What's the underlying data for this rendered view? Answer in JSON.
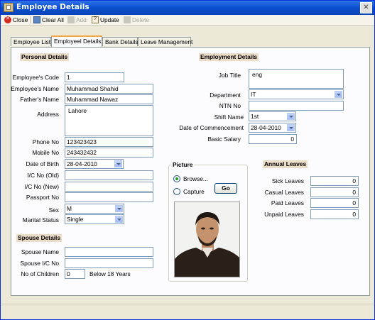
{
  "window": {
    "title": "Employee Details",
    "close_glyph": "✕"
  },
  "toolbar": {
    "close_label": "Close",
    "clear_all_label": "Clear All",
    "add_label": "Add",
    "update_label": "Update",
    "delete_label": "Delete"
  },
  "tabs": [
    "Employee List",
    "Employeel Details",
    "Bank Details",
    "Leave Management"
  ],
  "personal": {
    "section_title": "Personal Details",
    "employee_code": {
      "label": "Employee's Code",
      "value": "1"
    },
    "employee_name": {
      "label": "Employee's Name",
      "value": "Muhammad Shahid"
    },
    "father_name": {
      "label": "Father's Name",
      "value": "Muhammad Nawaz"
    },
    "address": {
      "label": "Address",
      "value": "Lahore"
    },
    "phone": {
      "label": "Phone No",
      "value": "123423423"
    },
    "mobile": {
      "label": "Mobile No",
      "value": "243432432"
    },
    "dob": {
      "label": "Date of Birth",
      "value": "28-04-2010"
    },
    "ic_old": {
      "label": "I/C No (Old)",
      "value": ""
    },
    "ic_new": {
      "label": "I/C No (New)",
      "value": ""
    },
    "passport": {
      "label": "Passport No",
      "value": ""
    },
    "sex": {
      "label": "Sex",
      "value": "M"
    },
    "marital": {
      "label": "Marital Status",
      "value": "Single"
    }
  },
  "spouse": {
    "section_title": "Spouse Details",
    "name": {
      "label": "Spouse Name",
      "value": ""
    },
    "ic": {
      "label": "Spouse I/C No",
      "value": ""
    },
    "children": {
      "label": "No of Children",
      "value": "0",
      "suffix": "Below 18 Years"
    }
  },
  "employment": {
    "section_title": "Employment Details",
    "job_title": {
      "label": "Job Title",
      "value": "eng"
    },
    "department": {
      "label": "Department",
      "value": "IT"
    },
    "ntn": {
      "label": "NTN No",
      "value": ""
    },
    "shift": {
      "label": "Shift Name",
      "value": "1st"
    },
    "commencement": {
      "label": "Date of Commencement",
      "value": "28-04-2010"
    },
    "salary": {
      "label": "Basic Salary",
      "value": "0"
    }
  },
  "picture": {
    "title": "Picture",
    "browse_label": "Browse...",
    "capture_label": "Capture",
    "go_label": "Go",
    "selected": "browse"
  },
  "leaves": {
    "section_title": "Annual Leaves",
    "sick": {
      "label": "Sick Leaves",
      "value": "0"
    },
    "casual": {
      "label": "Casual Leaves",
      "value": "0"
    },
    "paid": {
      "label": "Paid Leaves",
      "value": "0"
    },
    "unpaid": {
      "label": "Unpaid Leaves",
      "value": "0"
    }
  },
  "colors": {
    "titlebar": "#0A4FCF",
    "section_bg": "#EADCC7",
    "tab_highlight": "#F5A83B"
  }
}
